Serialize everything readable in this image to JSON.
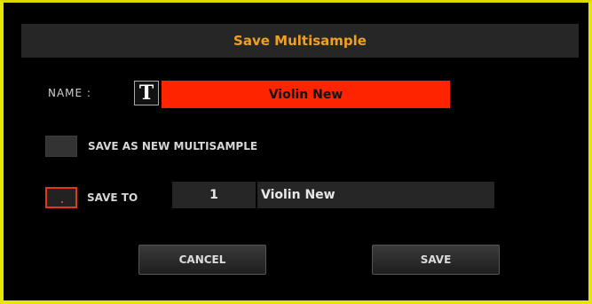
{
  "dialog": {
    "title": "Save Multisample"
  },
  "name_row": {
    "label": "NAME :",
    "text_icon_glyph": "T",
    "value": "Violin New"
  },
  "options": {
    "save_as_new_label": "SAVE AS NEW MULTISAMPLE",
    "save_as_new_checked": false,
    "save_to_label": "SAVE TO",
    "save_to_checked": true,
    "save_to_slot": "1",
    "save_to_name": "Violin New"
  },
  "buttons": {
    "cancel_label": "CANCEL",
    "save_label": "SAVE"
  },
  "colors": {
    "title_accent": "#f0a020",
    "name_field_bg": "#ff2400",
    "border": "#e6e600",
    "selected_checkbox": "#e03a1a"
  }
}
